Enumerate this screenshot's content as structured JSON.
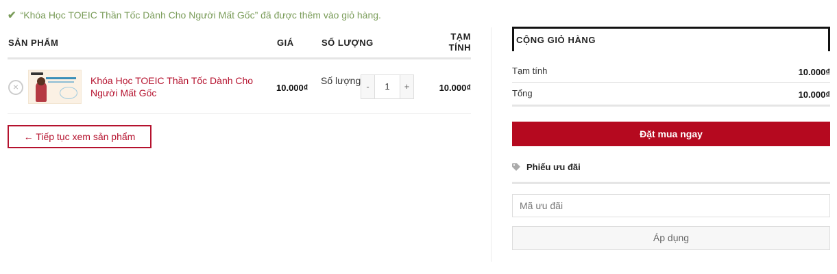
{
  "notice": {
    "text": "“Khóa Học TOEIC Thần Tốc Dành Cho Người Mất Gốc” đã được thêm vào giỏ hàng."
  },
  "cart": {
    "headers": {
      "product": "SẢN PHẨM",
      "price": "GIÁ",
      "quantity": "SỐ LƯỢNG",
      "subtotal_line1": "TẠM",
      "subtotal_line2": "TÍNH"
    },
    "item": {
      "name": "Khóa Học TOEIC Thần Tốc Dành Cho Người Mất Gốc",
      "price": "10.000₫",
      "quantity_label": "Số lượng",
      "quantity": "1",
      "subtotal": "10.000₫",
      "remove_symbol": "×",
      "minus": "-",
      "plus": "+"
    },
    "continue_label": "← Tiếp tục xem sản phẩm"
  },
  "totals": {
    "title": "CỘNG GIỎ HÀNG",
    "subtotal_label": "Tạm tính",
    "subtotal_value": "10.000₫",
    "total_label": "Tổng",
    "total_value": "10.000₫",
    "checkout_label": "Đặt mua ngay"
  },
  "coupon": {
    "title": "Phiếu ưu đãi",
    "placeholder": "Mã ưu đãi",
    "apply_label": "Áp dụng"
  },
  "colors": {
    "accent": "#b5091f",
    "notice": "#7a9c59"
  }
}
